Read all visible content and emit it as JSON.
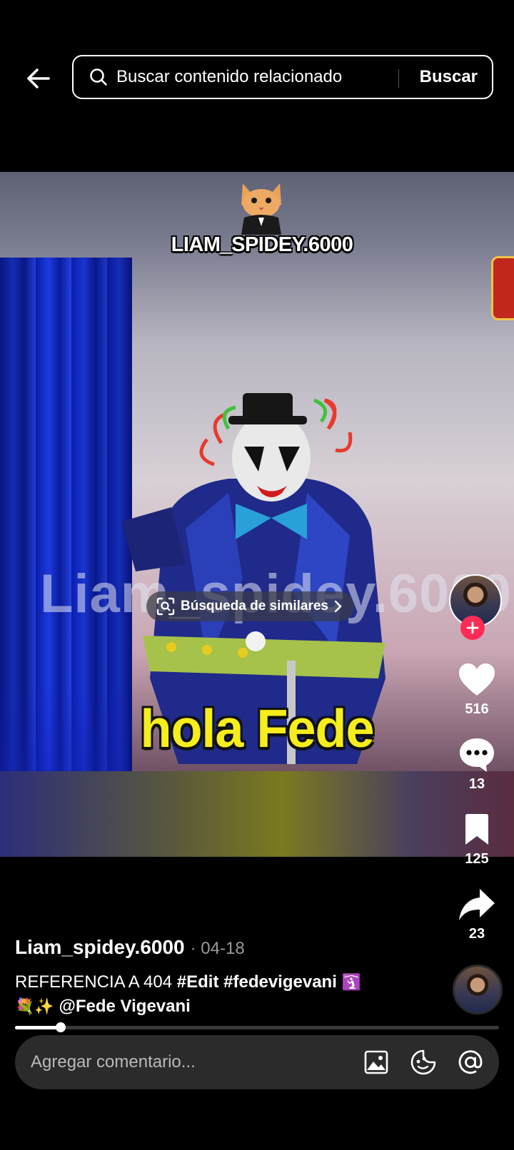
{
  "search": {
    "placeholder": "Buscar contenido relacionado",
    "button_label": "Buscar"
  },
  "video": {
    "creator_watermark": "LIAM_SPIDEY.6000",
    "background_watermark": "Liam_spidey.6000",
    "caption_overlay": "hola Fede",
    "similar_search_label": "Búsqueda de similares"
  },
  "actions": {
    "likes": "516",
    "comments": "13",
    "saves": "125",
    "shares": "23"
  },
  "post": {
    "author": "Liam_spidey.6000",
    "date": "· 04-18",
    "description_text": "REFERENCIA A 404 ",
    "hashtag_1": "#Edit",
    "hashtag_2": "#fedevigevani",
    "emoji_1": "🛐",
    "emoji_2": "💐✨",
    "mention": "@Fede Vigevani"
  },
  "playback": {
    "progress_fraction": 0.095
  },
  "comment": {
    "placeholder": "Agregar comentario..."
  },
  "colors": {
    "accent": "#fe2c55",
    "caption_yellow": "#f5ee1c"
  },
  "icons": [
    "back-arrow-icon",
    "search-icon",
    "similar-search-icon",
    "plus-icon",
    "heart-icon",
    "comment-icon",
    "bookmark-icon",
    "share-icon",
    "image-icon",
    "emoji-icon",
    "mention-icon"
  ]
}
